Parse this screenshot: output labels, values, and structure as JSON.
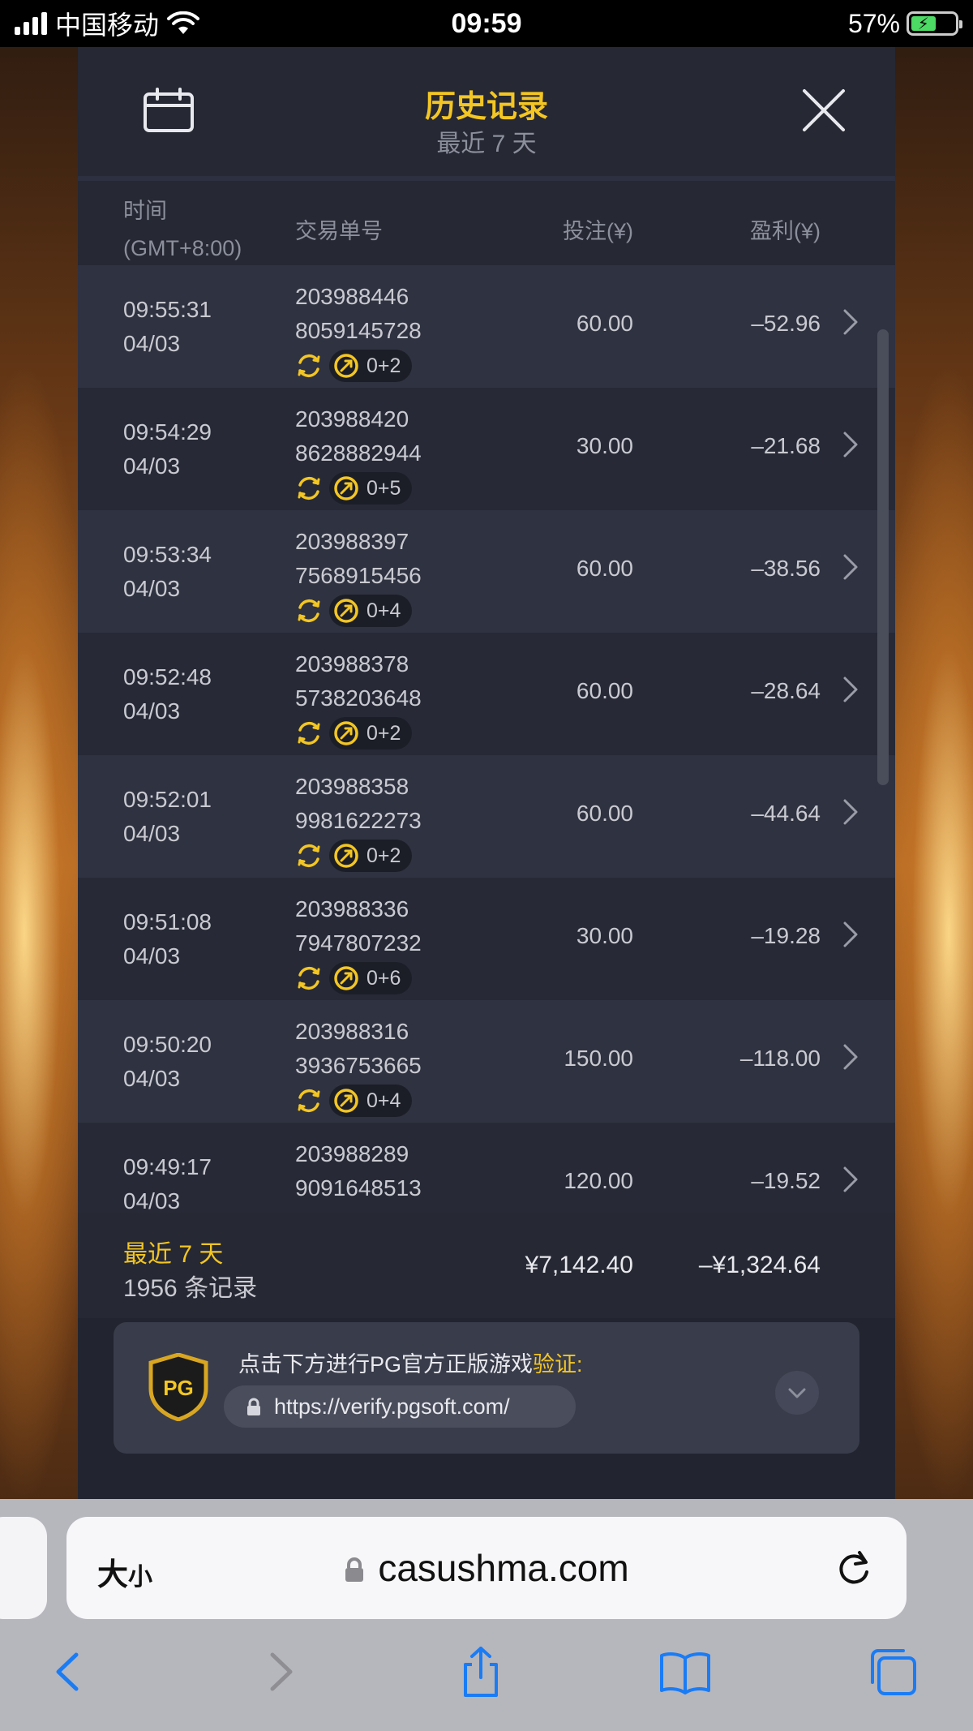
{
  "status_bar": {
    "carrier": "中国移动",
    "time": "09:59",
    "battery": "57%"
  },
  "header": {
    "title": "历史记录",
    "subtitle": "最近 7 天"
  },
  "columns": {
    "time_line1": "时间",
    "time_line2": "(GMT+8:00)",
    "id": "交易单号",
    "bet": "投注(¥)",
    "profit": "盈利(¥)"
  },
  "rows": [
    {
      "time": "09:55:31",
      "date": "04/03",
      "id1": "203988446",
      "id2": "8059145728",
      "free": "0+2",
      "bet": "60.00",
      "profit": "–52.96"
    },
    {
      "time": "09:54:29",
      "date": "04/03",
      "id1": "203988420",
      "id2": "8628882944",
      "free": "0+5",
      "bet": "30.00",
      "profit": "–21.68"
    },
    {
      "time": "09:53:34",
      "date": "04/03",
      "id1": "203988397",
      "id2": "7568915456",
      "free": "0+4",
      "bet": "60.00",
      "profit": "–38.56"
    },
    {
      "time": "09:52:48",
      "date": "04/03",
      "id1": "203988378",
      "id2": "5738203648",
      "free": "0+2",
      "bet": "60.00",
      "profit": "–28.64"
    },
    {
      "time": "09:52:01",
      "date": "04/03",
      "id1": "203988358",
      "id2": "9981622273",
      "free": "0+2",
      "bet": "60.00",
      "profit": "–44.64"
    },
    {
      "time": "09:51:08",
      "date": "04/03",
      "id1": "203988336",
      "id2": "7947807232",
      "free": "0+6",
      "bet": "30.00",
      "profit": "–19.28"
    },
    {
      "time": "09:50:20",
      "date": "04/03",
      "id1": "203988316",
      "id2": "3936753665",
      "free": "0+4",
      "bet": "150.00",
      "profit": "–118.00"
    },
    {
      "time": "09:49:17",
      "date": "04/03",
      "id1": "203988289",
      "id2": "9091648513",
      "free": "",
      "bet": "120.00",
      "profit": "–19.52"
    }
  ],
  "summary": {
    "label": "最近 7 天",
    "count": "1956 条记录",
    "total_bet": "¥7,142.40",
    "total_profit": "–¥1,324.64"
  },
  "verify": {
    "text": "点击下方进行PG官方正版游戏",
    "highlight": "验证:",
    "url": "https://verify.pgsoft.com/",
    "logo": "PG"
  },
  "browser": {
    "text_size": "大",
    "text_size_small": "小",
    "url": "casushma.com"
  },
  "colors": {
    "accent": "#f3c623",
    "panel": "#22252f",
    "row_odd": "#2f3240",
    "row_even": "#272a36"
  }
}
